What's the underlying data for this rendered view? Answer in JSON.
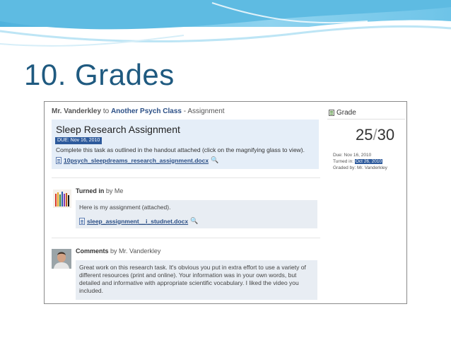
{
  "slide": {
    "title": "10. Grades"
  },
  "header": {
    "teacher": "Mr. Vanderkley",
    "to": "to",
    "class_name": "Another Psych Class",
    "suffix": "- Assignment"
  },
  "assignment": {
    "title": "Sleep Research Assignment",
    "due_badge": "DUE: Nov 16, 2010",
    "description": "Complete this task as outlined in the handout attached (click on the magnifying glass to view).",
    "file": "10psych_sleepdreams_research_assignment.docx"
  },
  "turned_in": {
    "label": "Turned in",
    "by": "by Me",
    "text": "Here is my assignment (attached).",
    "file": "sleep_assignment__i_studnet.docx"
  },
  "comments": {
    "label": "Comments",
    "by": "by Mr. Vanderkley",
    "lines": [
      "Great work on this research task. It's obvious you put in extra effort to use a variety of",
      "different resources (print and online). Your information was in your own words, but",
      "detailed and informative with appropriate scientific vocabulary. I liked the video you",
      "included."
    ]
  },
  "grade": {
    "heading": "Grade",
    "score": "25",
    "slash": "/",
    "max": "30",
    "due_label": "Due: Nov 16, 2010",
    "turned_in_label": "Turned in:",
    "turned_in_date": "Oct 26, 2010",
    "graded_by": "Graded by: Mr. Vanderkley"
  },
  "colors": {
    "title": "#1f5a80",
    "accent": "#2d5a9c",
    "link": "#2b4f86"
  },
  "icons": {
    "file": "document-icon",
    "preview": "magnifier-icon",
    "grade": "gradebook-icon"
  }
}
